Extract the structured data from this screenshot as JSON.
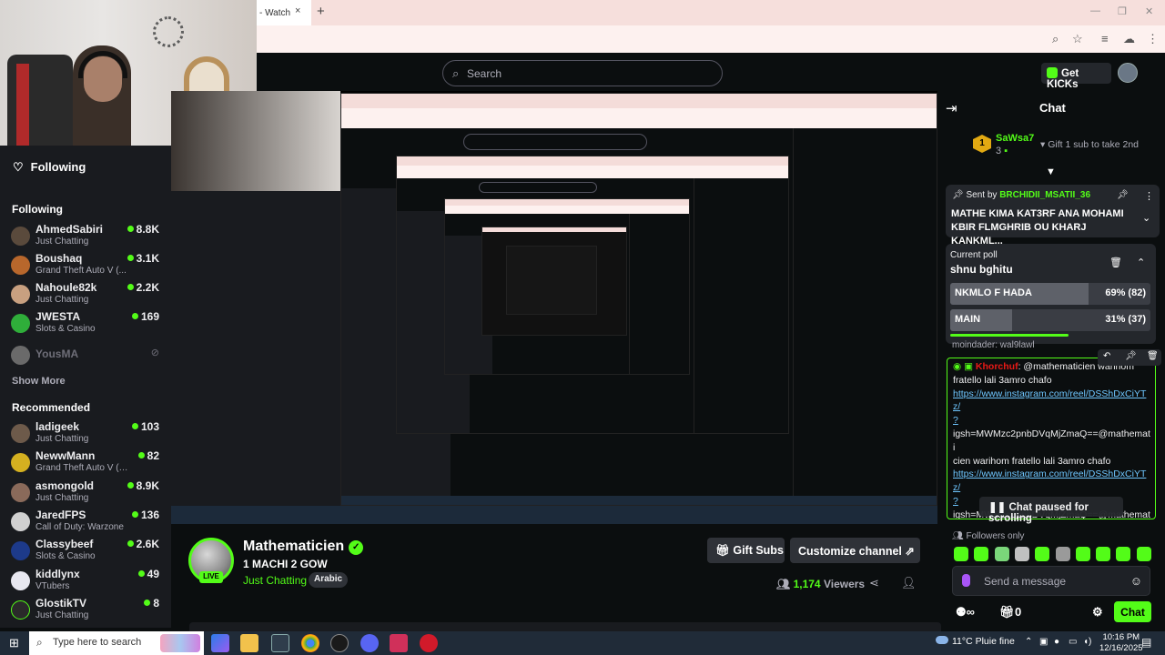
{
  "browser": {
    "tab_title": "- Watch",
    "tab_close": "×",
    "new_tab": "+"
  },
  "header": {
    "search_placeholder": "Search",
    "get_kicks_label": "Get KICKs"
  },
  "sidebar": {
    "following_nav_label": "Following",
    "following_section": "Following",
    "following": [
      {
        "name": "AhmedSabiri",
        "category": "Just Chatting",
        "viewers": "8.8K",
        "avatar_color": "#5a4a3c"
      },
      {
        "name": "Boushaq",
        "category": "Grand Theft Auto V (...",
        "viewers": "3.1K",
        "avatar_color": "#b8672c"
      },
      {
        "name": "Nahoule82k",
        "category": "Just Chatting",
        "viewers": "2.2K",
        "avatar_color": "#c8a080"
      },
      {
        "name": "JWESTA",
        "category": "Slots & Casino",
        "viewers": "169",
        "avatar_color": "#2fae3a"
      },
      {
        "name": "YousMA",
        "offline": true,
        "avatar_color": "#6a6a6a"
      }
    ],
    "show_more_1": "Show More",
    "recommended_section": "Recommended",
    "recommended": [
      {
        "name": "ladigeek",
        "category": "Just Chatting",
        "viewers": "103",
        "avatar_color": "#6d5a4a"
      },
      {
        "name": "NewwMann",
        "category": "Grand Theft Auto V (GTA)",
        "viewers": "82",
        "avatar_color": "#d4b020"
      },
      {
        "name": "asmongold",
        "category": "Just Chatting",
        "viewers": "8.9K",
        "avatar_color": "#8a6a5a"
      },
      {
        "name": "JaredFPS",
        "category": "Call of Duty: Warzone",
        "viewers": "136",
        "avatar_color": "#d0d0d0"
      },
      {
        "name": "Classybeef",
        "category": "Slots & Casino",
        "viewers": "2.6K",
        "avatar_color": "#1d3a8a"
      },
      {
        "name": "kiddlynx",
        "category": "VTubers",
        "viewers": "49",
        "avatar_color": "#e8e8f0"
      },
      {
        "name": "GlostikTV",
        "category": "Just Chatting",
        "viewers": "8",
        "avatar_color": "#2a2a2a"
      }
    ]
  },
  "stream": {
    "streamer": "Mathematicien",
    "live_label": "LIVE",
    "title": "1 MACHI 2 GOW",
    "category": "Just Chatting",
    "tag": "Arabic",
    "gift_subs_label": "Gift Subs",
    "customize_label": "Customize channel",
    "viewers_count": "1,174",
    "viewers_label": "Viewers"
  },
  "chat": {
    "title": "Chat",
    "gifter_rank": "1",
    "gifter_name": "SaWsa7",
    "gifter_count": "3",
    "gift_prompt": "Gift 1 sub to take 2nd",
    "pinned": {
      "sent_by": "Sent by",
      "user": "BRCHIDII_MSATII_36",
      "message": "MATHE KIMA KAT3RF ANA MOHAMI KBIR FLMGHRIB OU KHARJ KANKML..."
    },
    "poll": {
      "label": "Current poll",
      "question": "shnu bghitu",
      "options": [
        {
          "text": "NKMLO F HADA",
          "percent": "69% (82)",
          "fraction": 0.69
        },
        {
          "text": "MAIN",
          "percent": "31% (37)",
          "fraction": 0.31
        }
      ]
    },
    "behind_message": "moindader: wal9lawl",
    "message": {
      "author": "Khorchuf",
      "lines": [
        {
          "text": ": @mathematicien warihom",
          "link": false
        },
        {
          "text": "fratello lali 3amro chafo",
          "link": false
        },
        {
          "text": "https://www.instagram.com/reel/DSShDxCiYTz/",
          "link": true
        },
        {
          "text": "?",
          "link": true
        },
        {
          "text": "igsh=MWMzc2pnbDVqMjZmaQ==@mathemati",
          "link": false
        },
        {
          "text": "cien warihom fratello lali 3amro chafo",
          "link": false
        },
        {
          "text": "https://www.instagram.com/reel/DSShDxCiYTz/",
          "link": true
        },
        {
          "text": "?",
          "link": true
        },
        {
          "text": "igsh=MWMzc2pnbDVqMjZmaQ==@mathemati",
          "link": false
        },
        {
          "text": "cien warihom fratello lali 3amro chafo",
          "link": false
        },
        {
          "text": "https://www.instagram.com/reel/DSShDxCiYTz/",
          "link": true
        }
      ]
    },
    "paused_label": "Chat paused for scrolling",
    "followers_only": "Followers only",
    "send_placeholder": "Send a message",
    "kicks_count": "0",
    "chat_button": "Chat"
  },
  "taskbar": {
    "search_placeholder": "Type here to search",
    "weather": "11°C  Pluie fine",
    "time": "10:16 PM",
    "date": "12/16/2025"
  },
  "colors": {
    "accent": "#53fc18",
    "background": "#0b0e0f",
    "sidebar": "#191b1f"
  }
}
